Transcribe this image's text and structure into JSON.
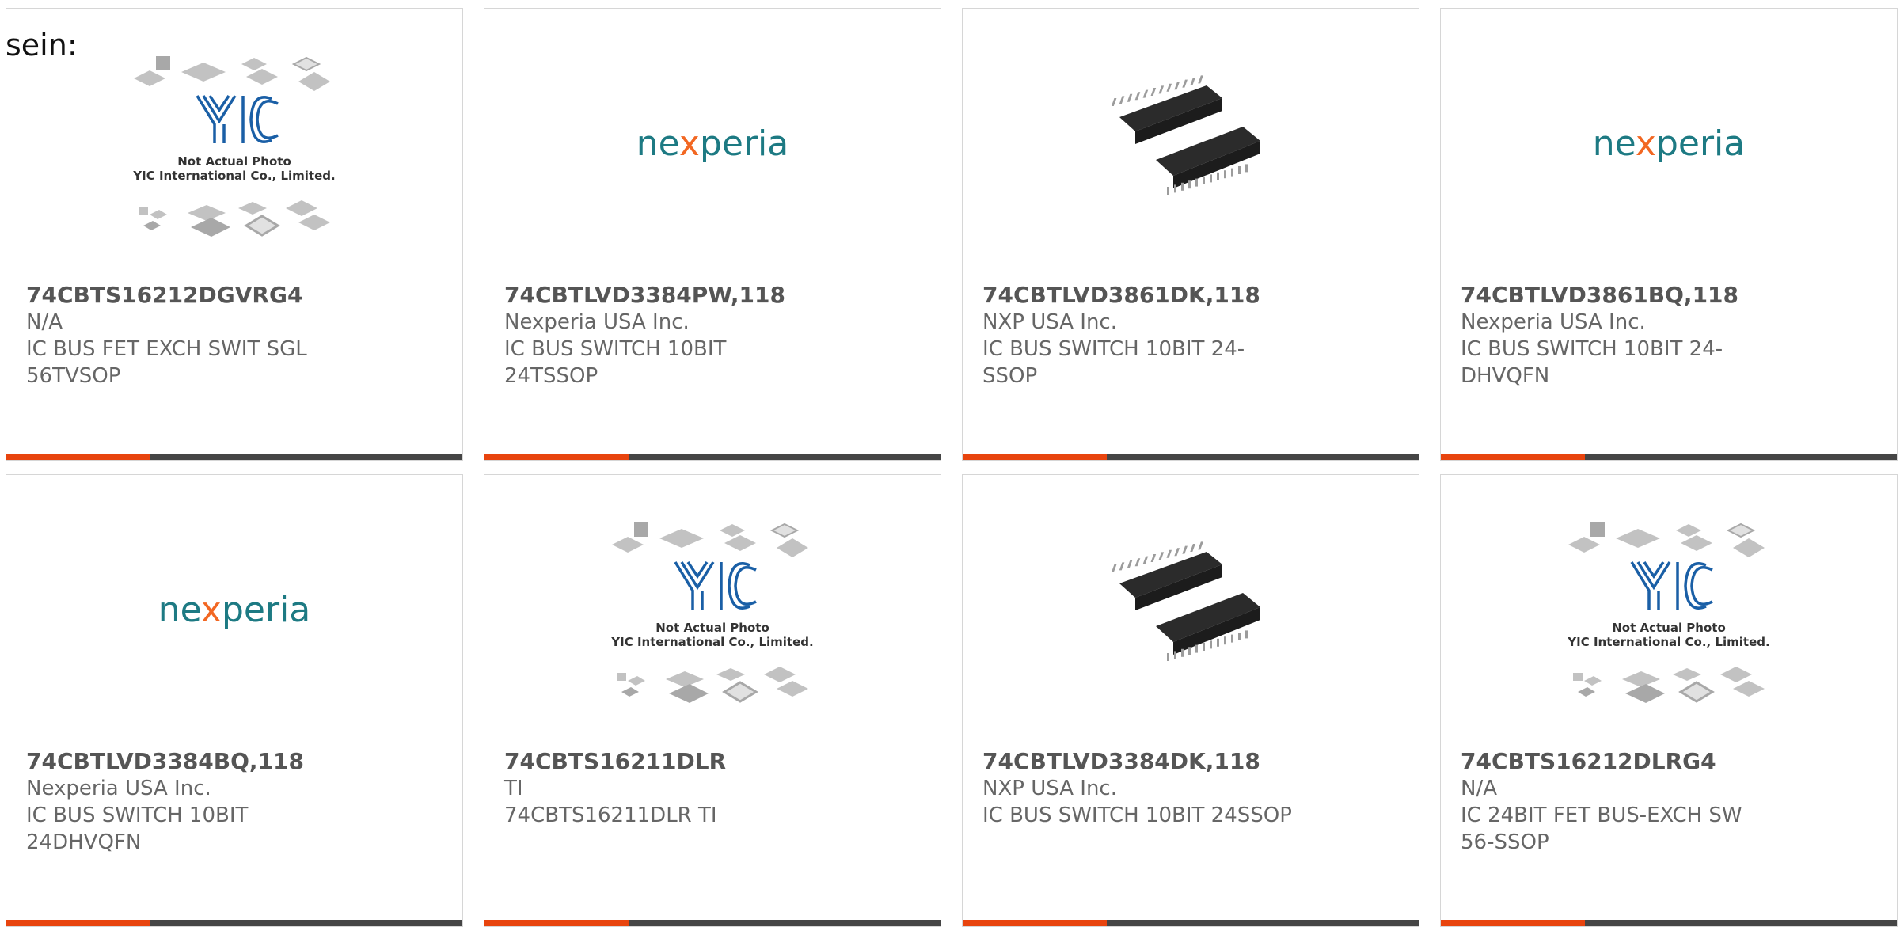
{
  "page": {
    "heading": "sein:"
  },
  "colors": {
    "accent": "#e8440e",
    "bar": "#454545",
    "nexperia_teal": "#1d7a83",
    "nexperia_orange": "#f26722",
    "yic_blue": "#1a5fa6"
  },
  "images": {
    "yic_placeholder": {
      "line1": "Not Actual Photo",
      "line2": "YIC International Co., Limited.",
      "logo": "YIC"
    },
    "nexperia_logo": {
      "prefix": "ne",
      "x": "x",
      "suffix": "peria"
    }
  },
  "cards": [
    {
      "image": "yic-placeholder",
      "part_number": "74CBTS16212DGVRG4",
      "manufacturer": "N/A",
      "description": "IC BUS FET EXCH SWIT SGL 56TVSOP"
    },
    {
      "image": "nexperia-logo",
      "part_number": "74CBTLVD3384PW,118",
      "manufacturer": "Nexperia USA Inc.",
      "description": "IC BUS SWITCH 10BIT 24TSSOP"
    },
    {
      "image": "ssop-chip-photo",
      "part_number": "74CBTLVD3861DK,118",
      "manufacturer": "NXP USA Inc.",
      "description": "IC BUS SWITCH 10BIT 24-SSOP"
    },
    {
      "image": "nexperia-logo",
      "part_number": "74CBTLVD3861BQ,118",
      "manufacturer": "Nexperia USA Inc.",
      "description": "IC BUS SWITCH 10BIT 24-DHVQFN"
    },
    {
      "image": "nexperia-logo",
      "part_number": "74CBTLVD3384BQ,118",
      "manufacturer": "Nexperia USA Inc.",
      "description": "IC BUS SWITCH 10BIT 24DHVQFN"
    },
    {
      "image": "yic-placeholder",
      "part_number": "74CBTS16211DLR",
      "manufacturer": "TI",
      "description": "74CBTS16211DLR TI"
    },
    {
      "image": "ssop-chip-photo",
      "part_number": "74CBTLVD3384DK,118",
      "manufacturer": "NXP USA Inc.",
      "description": "IC BUS SWITCH 10BIT 24SSOP"
    },
    {
      "image": "yic-placeholder",
      "part_number": "74CBTS16212DLRG4",
      "manufacturer": "N/A",
      "description": "IC 24BIT FET BUS-EXCH SW 56-SSOP"
    }
  ]
}
